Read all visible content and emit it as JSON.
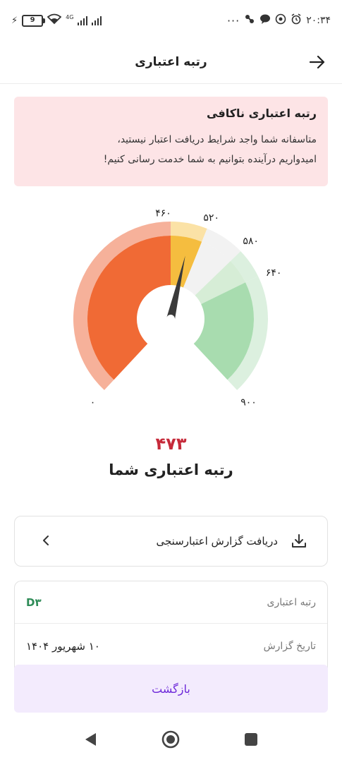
{
  "status_bar": {
    "battery": "9",
    "network": "4G",
    "dots": "···",
    "time": "۲۰:۳۴"
  },
  "header": {
    "title": "رتبه اعتباری"
  },
  "alert": {
    "title": "رتبه اعتباری ناکافی",
    "body": "متاسفانه شما واجد شرایط دریافت اعتبار نیستید،\nامیدواریم درآینده بتوانیم به شما خدمت رسانی کنیم!",
    "background": "#fde4e6"
  },
  "gauge": {
    "ticks": [
      "۰",
      "۴۶۰",
      "۵۲۰",
      "۵۸۰",
      "۶۴۰",
      "۹۰۰"
    ],
    "min": 0,
    "max": 900,
    "value": 473,
    "colors": {
      "low": "#f06a35",
      "low_light": "#f6b19a",
      "mid": "#f5bd3f",
      "mid_light": "#fbe2a6",
      "neutral_light": "#f2f2f2",
      "good_light": "#d6edd6",
      "high": "#a8dcaf",
      "high_light": "#dcf0df",
      "needle": "#3a3a3a"
    }
  },
  "score": {
    "value": "۴۷۳",
    "label": "رتبه اعتباری شما"
  },
  "report": {
    "label": "دریافت گزارش اعتبارسنجی"
  },
  "info": {
    "rows": [
      {
        "key": "رتبه اعتباری",
        "value": "D۳"
      },
      {
        "key": "تاریخ گزارش",
        "value": "۱۰ شهریور ۱۴۰۴"
      }
    ]
  },
  "footer": {
    "back_label": "بازگشت",
    "accent": "#6d28d9"
  }
}
